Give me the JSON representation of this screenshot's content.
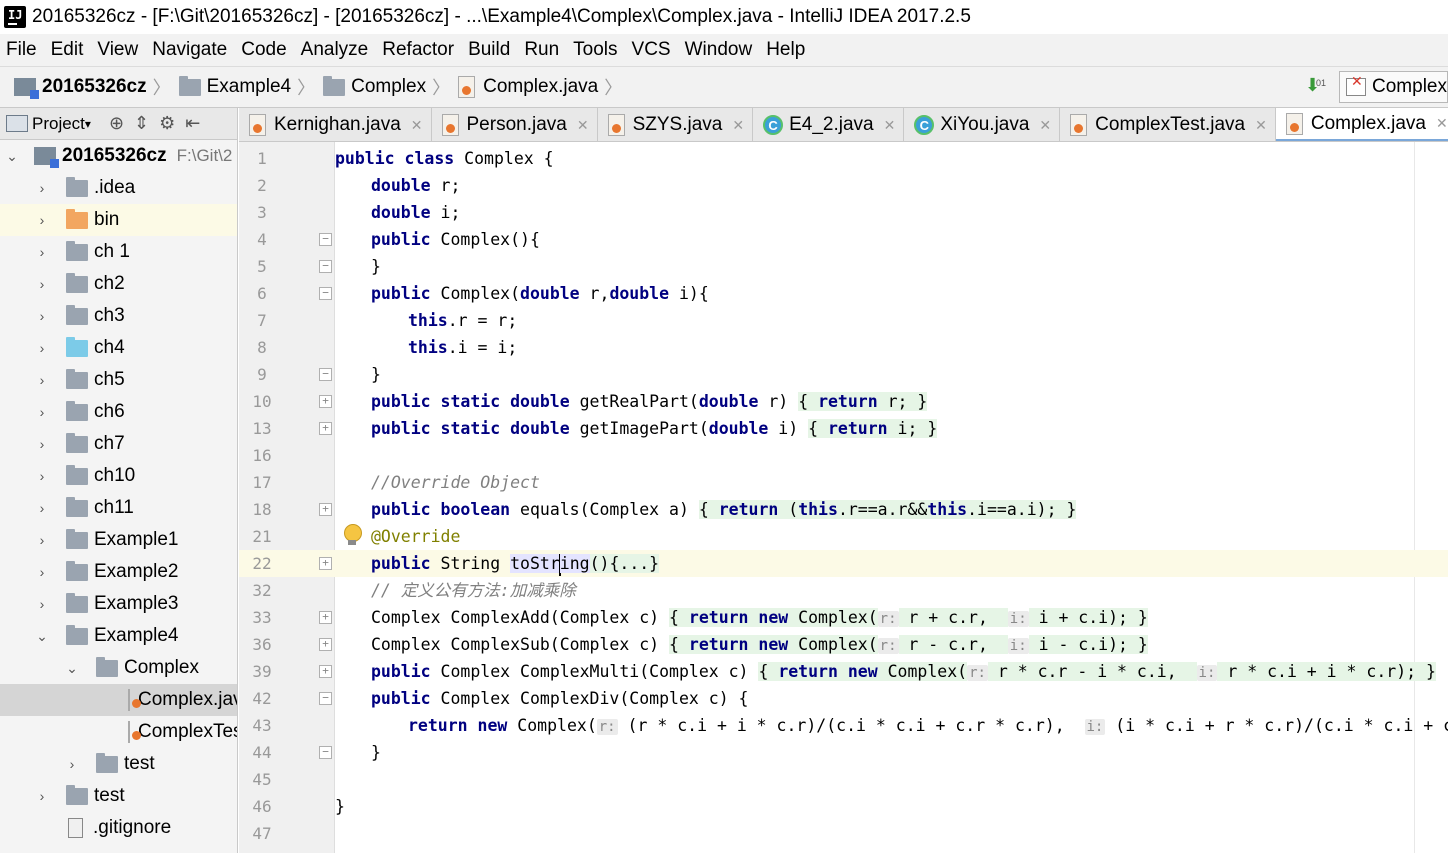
{
  "window": {
    "title": "20165326cz - [F:\\Git\\20165326cz] - [20165326cz] - ...\\Example4\\Complex\\Complex.java - IntelliJ IDEA 2017.2.5"
  },
  "menu": [
    "File",
    "Edit",
    "View",
    "Navigate",
    "Code",
    "Analyze",
    "Refactor",
    "Build",
    "Run",
    "Tools",
    "VCS",
    "Window",
    "Help"
  ],
  "breadcrumbs": [
    "20165326cz",
    "Example4",
    "Complex",
    "Complex.java"
  ],
  "run_config": "Complex",
  "sidebar": {
    "toolbar_label": "Project",
    "root": {
      "name": "20165326cz",
      "path": "F:\\Git\\2"
    },
    "items": [
      {
        "label": ".idea"
      },
      {
        "label": "bin"
      },
      {
        "label": "ch 1"
      },
      {
        "label": "ch2"
      },
      {
        "label": "ch3"
      },
      {
        "label": "ch4"
      },
      {
        "label": "ch5"
      },
      {
        "label": "ch6"
      },
      {
        "label": "ch7"
      },
      {
        "label": "ch10"
      },
      {
        "label": "ch11"
      },
      {
        "label": "Example1"
      },
      {
        "label": "Example2"
      },
      {
        "label": "Example3"
      },
      {
        "label": "Example4"
      },
      {
        "label": "Complex"
      },
      {
        "label": "Complex.java"
      },
      {
        "label": "ComplexTest.java"
      },
      {
        "label": "test"
      },
      {
        "label": "test"
      },
      {
        "label": ".gitignore"
      }
    ]
  },
  "tabs": [
    "Kernighan.java",
    "Person.java",
    "SZYS.java",
    "E4_2.java",
    "XiYou.java",
    "ComplexTest.java",
    "Complex.java"
  ],
  "code_lines": [
    {
      "n": "1"
    },
    {
      "n": "2"
    },
    {
      "n": "3"
    },
    {
      "n": "4"
    },
    {
      "n": "5"
    },
    {
      "n": "6"
    },
    {
      "n": "7"
    },
    {
      "n": "8"
    },
    {
      "n": "9"
    },
    {
      "n": "10"
    },
    {
      "n": "13"
    },
    {
      "n": "16"
    },
    {
      "n": "17"
    },
    {
      "n": "18"
    },
    {
      "n": "21"
    },
    {
      "n": "22"
    },
    {
      "n": "32"
    },
    {
      "n": "33"
    },
    {
      "n": "36"
    },
    {
      "n": "39"
    },
    {
      "n": "42"
    },
    {
      "n": "43"
    },
    {
      "n": "44"
    },
    {
      "n": "45"
    },
    {
      "n": "46"
    },
    {
      "n": "47"
    }
  ],
  "code_text": {
    "l1_kw": "public class",
    "l1_rest": " Complex {",
    "l2": "double",
    "l2_rest": " r;",
    "l3": "double",
    "l3_rest": " i;",
    "l4_kw": "public",
    "l4_rest": " Complex(){",
    "l5": "}",
    "l6_kw": "public",
    "l6_a": " Complex(",
    "l6_kw2": "double",
    "l6_b": " r,",
    "l6_kw3": "double",
    "l6_c": " i){",
    "l7_kw": "this",
    "l7_rest": ".r = r;",
    "l8_kw": "this",
    "l8_rest": ".i = i;",
    "l9": "}",
    "l10_kw": "public static double",
    "l10_a": " getRealPart(",
    "l10_kw2": "double",
    "l10_b": " r) ",
    "l10_c": "{ ",
    "l10_kw3": "return",
    "l10_d": " r; ",
    "l10_e": "}",
    "l13_kw": "public static double",
    "l13_a": " getImagePart(",
    "l13_kw2": "double",
    "l13_b": " i) ",
    "l13_c": "{ ",
    "l13_kw3": "return",
    "l13_d": " i; ",
    "l13_e": "}",
    "l17": "//Override Object",
    "l18_kw": "public boolean",
    "l18_a": " equals(Complex a) ",
    "l18_b": "{ ",
    "l18_kw2": "return",
    "l18_c": " (",
    "l18_kw3": "this",
    "l18_d": ".r==a.r&&",
    "l18_kw4": "this",
    "l18_e": ".i==a.i); ",
    "l18_f": "}",
    "l21": "@Override",
    "l22_kw": "public",
    "l22_a": " String ",
    "l22_b": "toStr",
    "l22_c": "ing",
    "l22_d": "(){...}",
    "l32": "// 定义公有方法:加减乘除",
    "l33_a": "Complex ComplexAdd(Complex c) ",
    "l33_b": "{ ",
    "l33_kw": "return new",
    "l33_c": " Complex(",
    "l33_h1": "r:",
    "l33_d": " r + c.r,  ",
    "l33_h2": "i:",
    "l33_e": " i + c.i); ",
    "l33_f": "}",
    "l36_a": "Complex ComplexSub(Complex c) ",
    "l36_b": "{ ",
    "l36_kw": "return new",
    "l36_c": " Complex(",
    "l36_h1": "r:",
    "l36_d": " r - c.r,  ",
    "l36_h2": "i:",
    "l36_e": " i - c.i); ",
    "l36_f": "}",
    "l39_kw": "public",
    "l39_a": " Complex ComplexMulti(Complex c) ",
    "l39_b": "{ ",
    "l39_kw2": "return new",
    "l39_c": " Complex(",
    "l39_h1": "r:",
    "l39_d": " r * c.r - i * c.i,  ",
    "l39_h2": "i:",
    "l39_e": " r * c.i + i * c.r); ",
    "l39_f": "}",
    "l42_kw": "public",
    "l42_a": " Complex ComplexDiv(Complex c) {",
    "l43_kw": "return new",
    "l43_a": " Complex(",
    "l43_h1": "r:",
    "l43_b": " (r * c.i + i * c.r)/(c.i * c.i + c.r * c.r),  ",
    "l43_h2": "i:",
    "l43_c": " (i * c.i + r * c.r)/(c.i * c.i + c.r * c.r));",
    "l44": "}",
    "l46": "}"
  }
}
